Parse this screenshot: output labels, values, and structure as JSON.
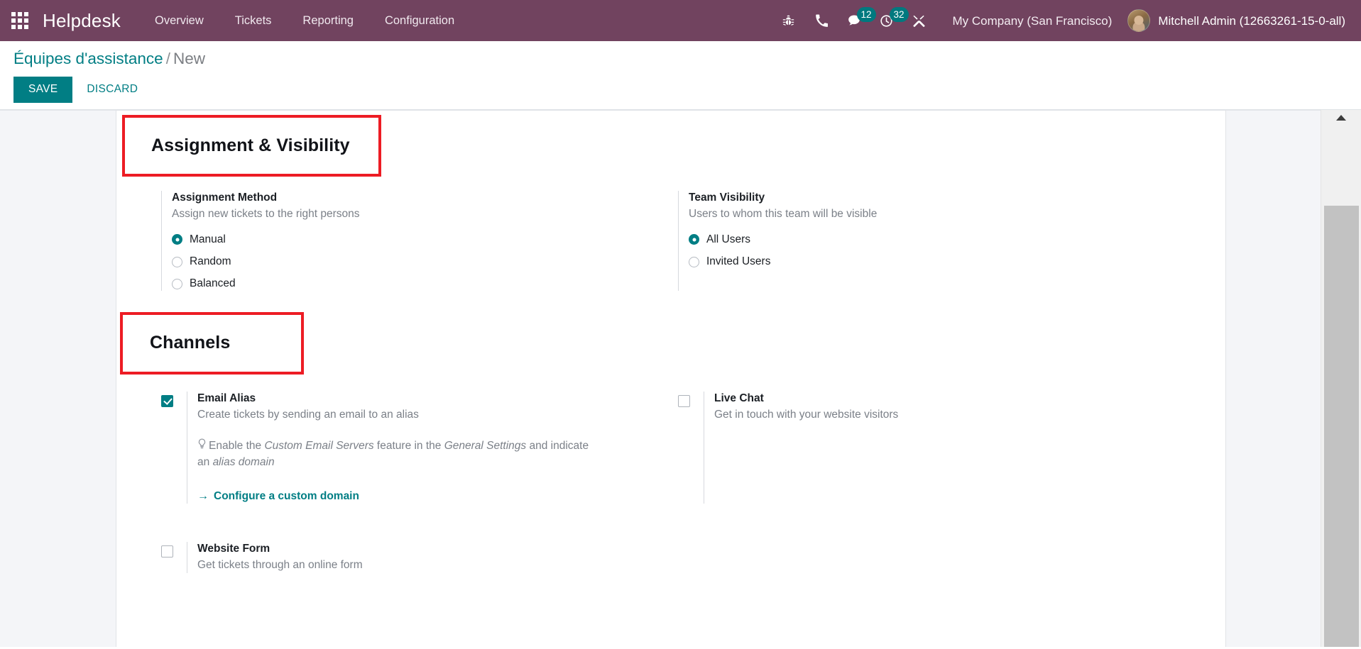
{
  "navbar": {
    "apps_icon": "apps-grid-icon",
    "brand": "Helpdesk",
    "menu": [
      {
        "label": "Overview"
      },
      {
        "label": "Tickets"
      },
      {
        "label": "Reporting"
      },
      {
        "label": "Configuration"
      }
    ],
    "sys_icons": [
      {
        "name": "bug-icon",
        "badge": null
      },
      {
        "name": "phone-icon",
        "badge": null
      },
      {
        "name": "messages-icon",
        "badge": "12"
      },
      {
        "name": "activities-clock-icon",
        "badge": "32"
      },
      {
        "name": "developer-tools-icon",
        "badge": null
      }
    ],
    "company": "My Company (San Francisco)",
    "user": "Mitchell Admin (12663261-15-0-all)"
  },
  "control_panel": {
    "breadcrumb_root": "Équipes d'assistance",
    "breadcrumb_sep": "/",
    "breadcrumb_current": "New",
    "save_label": "SAVE",
    "discard_label": "DISCARD"
  },
  "sections": {
    "assignment": {
      "title": "Assignment & Visibility",
      "assignment_method": {
        "label": "Assignment Method",
        "description": "Assign new tickets to the right persons",
        "options": [
          {
            "label": "Manual",
            "selected": true
          },
          {
            "label": "Random",
            "selected": false
          },
          {
            "label": "Balanced",
            "selected": false
          }
        ]
      },
      "team_visibility": {
        "label": "Team Visibility",
        "description": "Users to whom this team will be visible",
        "options": [
          {
            "label": "All Users",
            "selected": true
          },
          {
            "label": "Invited Users",
            "selected": false
          }
        ]
      }
    },
    "channels": {
      "title": "Channels",
      "email_alias": {
        "label": "Email Alias",
        "description": "Create tickets by sending an email to an alias",
        "checked": true,
        "tip_part1": "Enable the ",
        "tip_em1": "Custom Email Servers",
        "tip_part2": " feature in the ",
        "tip_em2": "General Settings",
        "tip_part3": " and indicate an ",
        "tip_em3": "alias domain",
        "link_label": "Configure a custom domain",
        "link_arrow": "→"
      },
      "live_chat": {
        "label": "Live Chat",
        "description": "Get in touch with your website visitors",
        "checked": false
      },
      "website_form": {
        "label": "Website Form",
        "description": "Get tickets through an online form",
        "checked": false
      }
    }
  },
  "annotations": {
    "highlight_color": "#ed1c24",
    "boxes": [
      {
        "target": "assignment-visibility-title"
      },
      {
        "target": "channels-title"
      }
    ]
  },
  "theme": {
    "navbar_bg": "#71435f",
    "accent_teal": "#017e84",
    "page_bg": "#f4f5f8",
    "sheet_bg": "#ffffff"
  }
}
